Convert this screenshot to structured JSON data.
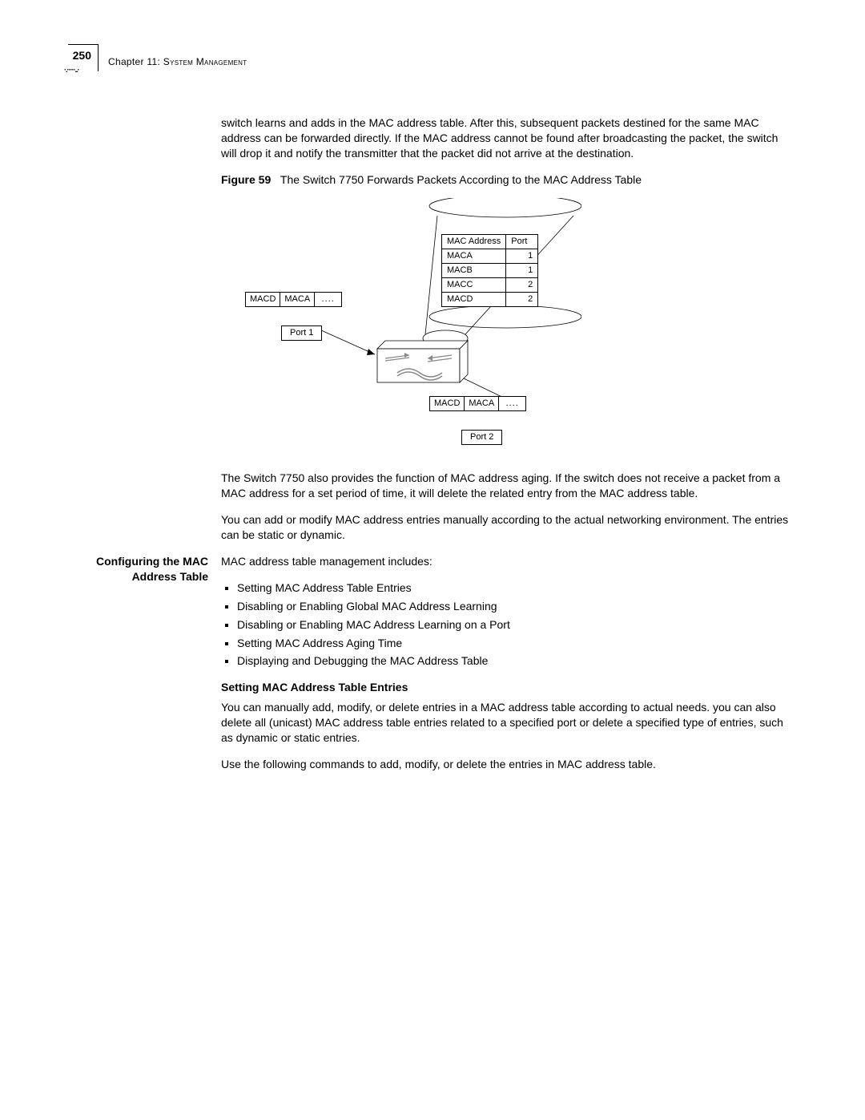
{
  "header": {
    "page_number": "250",
    "chapter_label": "Chapter 11: ",
    "chapter_title": "System Management"
  },
  "intro_para": "switch learns and adds in the MAC address table. After this, subsequent packets destined for the same MAC address can be forwarded directly. If the MAC address cannot be found after broadcasting the packet, the switch will drop it and notify the transmitter that the packet did not arrive at the destination.",
  "figure": {
    "label": "Figure 59",
    "caption": "The Switch 7750 Forwards Packets According to the MAC Address Table",
    "mac_table": {
      "headers": {
        "col1": "MAC Address",
        "col2": "Port"
      },
      "rows": [
        {
          "addr": "MACA",
          "port": "1"
        },
        {
          "addr": "MACB",
          "port": "1"
        },
        {
          "addr": "MACC",
          "port": "2"
        },
        {
          "addr": "MACD",
          "port": "2"
        }
      ]
    },
    "packet1": {
      "dst": "MACD",
      "src": "MACA",
      "rest": "...."
    },
    "port1_label": "Port 1",
    "packet2": {
      "dst": "MACD",
      "src": "MACA",
      "rest": "...."
    },
    "port2_label": "Port 2"
  },
  "para2": "The Switch 7750 also provides the function of MAC address aging. If the switch does not receive a packet from a MAC address for a set period of time, it will delete the related entry from the MAC address table.",
  "para3": "You can add or modify MAC address entries manually according to the actual networking environment. The entries can be static or dynamic.",
  "section": {
    "margin_title": "Configuring the MAC Address Table",
    "lead": "MAC address table management includes:",
    "bullets": [
      "Setting MAC Address Table Entries",
      "Disabling or Enabling Global MAC Address Learning",
      "Disabling or Enabling MAC Address Learning on a Port",
      "Setting MAC Address Aging Time",
      "Displaying and Debugging the MAC Address Table"
    ],
    "sub_head": "Setting MAC Address Table Entries",
    "sub_para1": "You can manually add, modify, or delete entries in a MAC address table according to actual needs. you can also delete all (unicast) MAC address table entries related to a specified port or delete a specified type of entries, such as dynamic or static entries.",
    "sub_para2": "Use the following commands to add, modify, or delete the entries in MAC address table."
  }
}
